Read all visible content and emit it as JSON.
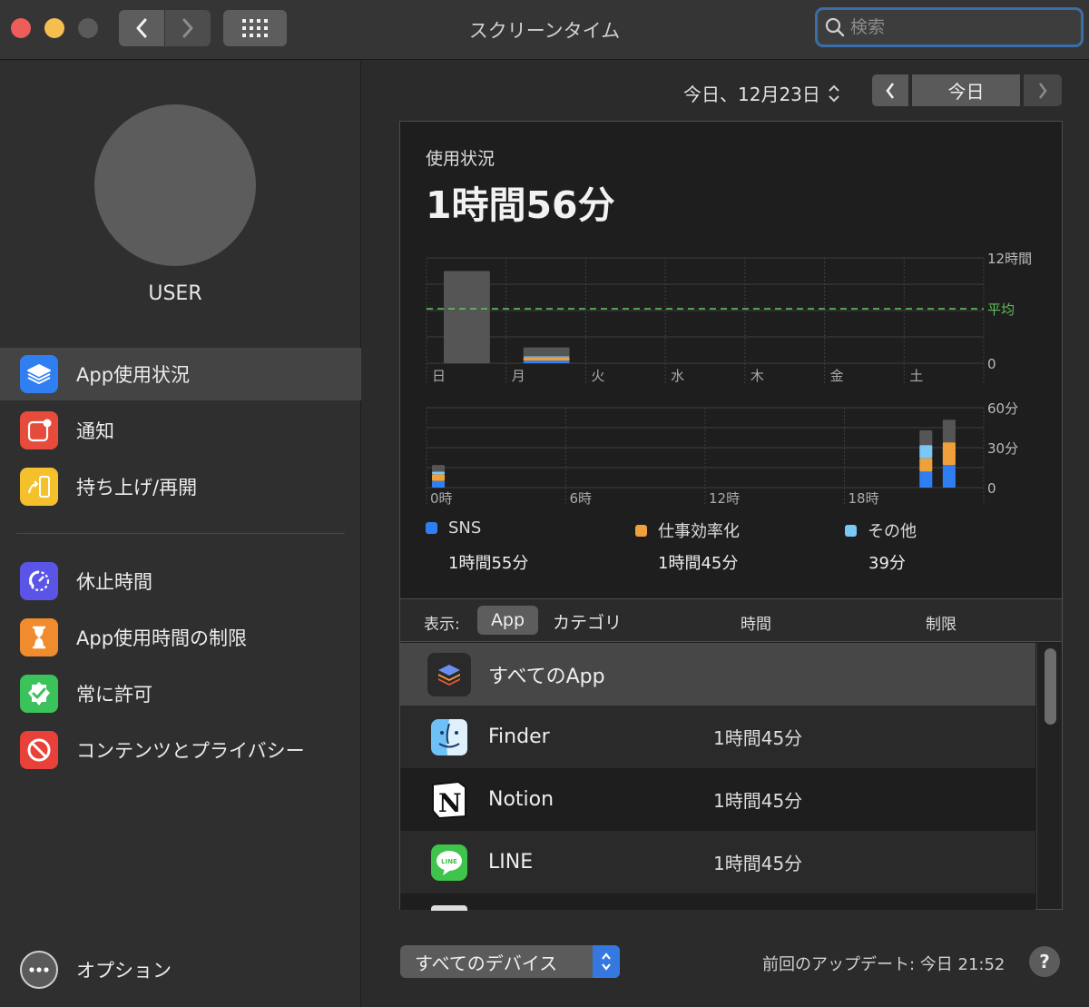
{
  "window": {
    "title": "スクリーンタイム",
    "search_placeholder": "検索"
  },
  "sidebar": {
    "user_name": "USER",
    "items": [
      {
        "label": "App使用状況",
        "icon": "layers-icon",
        "color": "#2f7ff2",
        "active": true
      },
      {
        "label": "通知",
        "icon": "notification-icon",
        "color": "#e74b3c"
      },
      {
        "label": "持ち上げ/再開",
        "icon": "pickup-icon",
        "color": "#f4c12c"
      },
      {
        "label": "休止時間",
        "icon": "downtime-icon",
        "color": "#5a55e6"
      },
      {
        "label": "App使用時間の制限",
        "icon": "hourglass-icon",
        "color": "#f08c2e"
      },
      {
        "label": "常に許可",
        "icon": "checkmark-badge-icon",
        "color": "#3cc25a"
      },
      {
        "label": "コンテンツとプライバシー",
        "icon": "prohibited-icon",
        "color": "#e8413a"
      }
    ],
    "options_label": "オプション"
  },
  "date_nav": {
    "date_label": "今日、12月23日",
    "today_label": "今日"
  },
  "usage": {
    "title": "使用状況",
    "total": "1時間56分"
  },
  "chart_data": [
    {
      "type": "bar",
      "title": "",
      "categories": [
        "日",
        "月",
        "火",
        "水",
        "木",
        "金",
        "土"
      ],
      "y_tick_labels": [
        "12時間",
        "0"
      ],
      "average_label": "平均",
      "ylim_hours": [
        0,
        12
      ],
      "average_hours": 6.2,
      "stacked": true,
      "series": [
        {
          "name": "SNS",
          "color": "#2f7ff2",
          "values": [
            0,
            0.3,
            0,
            0,
            0,
            0,
            0
          ]
        },
        {
          "name": "仕事効率化",
          "color": "#f0a03a",
          "values": [
            0,
            0.4,
            0,
            0,
            0,
            0,
            0
          ]
        },
        {
          "name": "その他",
          "color": "#79c8f5",
          "values": [
            0,
            0.1,
            0,
            0,
            0,
            0,
            0
          ]
        },
        {
          "color": "#555555",
          "values": [
            10.5,
            1.0,
            0,
            0,
            0,
            0,
            0
          ]
        }
      ]
    },
    {
      "type": "bar",
      "title": "",
      "tick_labels": [
        "0時",
        "6時",
        "12時",
        "18時"
      ],
      "y_tick_labels": [
        "60分",
        "30分",
        "0"
      ],
      "ylim_minutes": [
        0,
        60
      ],
      "stacked": true,
      "hours": [
        0,
        21,
        22
      ],
      "series": [
        {
          "name": "SNS",
          "color": "#2f7ff2",
          "values": [
            5,
            12,
            17
          ]
        },
        {
          "name": "仕事効率化",
          "color": "#f0a03a",
          "values": [
            5,
            10,
            17
          ]
        },
        {
          "name": "その他",
          "color": "#79c8f5",
          "values": [
            2,
            10,
            0
          ]
        },
        {
          "color": "#555555",
          "values": [
            5,
            11,
            17
          ]
        }
      ]
    }
  ],
  "legend": [
    {
      "name": "SNS",
      "value": "1時間55分",
      "color": "#2f7ff2"
    },
    {
      "name": "仕事効率化",
      "value": "1時間45分",
      "color": "#f0a03a"
    },
    {
      "name": "その他",
      "value": "39分",
      "color": "#79c8f5"
    }
  ],
  "list": {
    "show_label": "表示:",
    "tab_app": "App",
    "tab_category": "カテゴリ",
    "col_time": "時間",
    "col_limit": "制限",
    "rows": [
      {
        "name": "すべてのApp",
        "time": "",
        "icon": "all-apps-icon"
      },
      {
        "name": "Finder",
        "time": "1時間45分",
        "icon": "finder-icon"
      },
      {
        "name": "Notion",
        "time": "1時間45分",
        "icon": "notion-icon"
      },
      {
        "name": "LINE",
        "time": "1時間45分",
        "icon": "line-icon"
      }
    ]
  },
  "footer": {
    "device_select": "すべてのデバイス",
    "last_update": "前回のアップデート: 今日 21:52",
    "help": "?"
  }
}
